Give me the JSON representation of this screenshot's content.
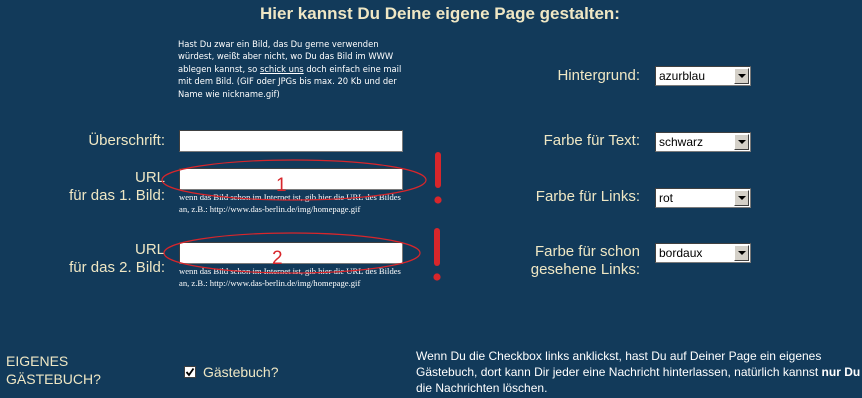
{
  "page": {
    "title": "Hier kannst Du Deine eigene Page gestalten:"
  },
  "image_hint": {
    "text_before": "Hast Du zwar ein Bild, das Du gerne verwenden würdest, weißt aber nicht, wo Du das Bild im WWW ablegen kannst, so ",
    "link": "schick uns",
    "text_after": " doch einfach eine mail mit dem Bild. (GIF oder JPGs bis max. 20 Kb und der Name wie nickname.gif)"
  },
  "form": {
    "headline_label": "Überschrift:",
    "headline_value": "",
    "url1_label_line1": "URL",
    "url1_label_line2": "für das 1. Bild:",
    "url1_value": "",
    "url1_hint": "wenn das Bild schon im Internet ist, gib hier die URL des Bildes an, z.B.: http://www.das-berlin.de/img/homepage.gif",
    "url2_label_line1": "URL",
    "url2_label_line2": "für das 2. Bild:",
    "url2_value": "",
    "url2_hint": "wenn das Bild schon im Internet ist, gib hier die URL des Bildes an, z.B.: http://www.das-berlin.de/img/homepage.gif"
  },
  "settings": {
    "background_label": "Hintergrund:",
    "background_value": "azurblau",
    "text_color_label": "Farbe für Text:",
    "text_color_value": "schwarz",
    "link_color_label": "Farbe für Links:",
    "link_color_value": "rot",
    "visited_label_line1": "Farbe für schon",
    "visited_label_line2": "gesehene Links:",
    "visited_value": "bordaux"
  },
  "annotations": {
    "mark1": "1",
    "mark2": "2",
    "exclamation": "!",
    "color": "#d8262b"
  },
  "guestbook": {
    "label_line1": "EIGENES",
    "label_line2": "GÄSTEBUCH?",
    "checkbox_label": "Gästebuch?",
    "checked": true,
    "desc_part1": "Wenn Du die Checkbox links anklickst, hast Du auf Deiner Page ein eigenes Gästebuch, dort kann Dir jeder eine Nachricht hinterlassen, natürlich kannst ",
    "desc_bold": "nur Du",
    "desc_part2": " die Nachrichten löschen."
  },
  "colors": {
    "background": "#123a5a",
    "label_text": "#efe7c4",
    "hint_text": "#ffffff"
  }
}
